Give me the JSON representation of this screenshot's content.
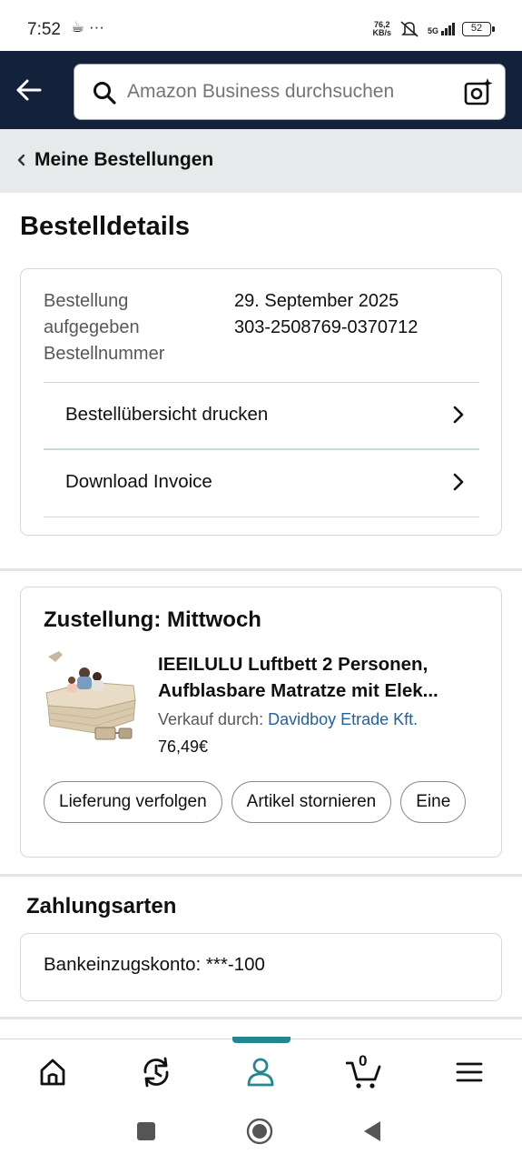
{
  "status_bar": {
    "time": "7:52",
    "notif_icons": "☕ ···",
    "speed_value": "76,2",
    "speed_unit": "KB/s",
    "network": "5G",
    "battery": "52"
  },
  "header": {
    "search_placeholder": "Amazon Business durchsuchen"
  },
  "breadcrumb": {
    "label": "Meine Bestellungen"
  },
  "page_title": "Bestelldetails",
  "order": {
    "label_placed_1": "Bestellung",
    "label_placed_2": "aufgegeben",
    "label_number": "Bestellnummer",
    "date": "29. September 2025",
    "number": "303-2508769-0370712",
    "print_link": "Bestellübersicht drucken",
    "invoice_link": "Download Invoice"
  },
  "delivery": {
    "title": "Zustellung: Mittwoch",
    "product_title_line1": "IEEILULU Luftbett 2 Personen,",
    "product_title_line2": "Aufblasbare Matratze mit Elek...",
    "seller_prefix": "Verkauf durch:",
    "seller_name": "Davidboy Etrade Kft.",
    "price": "76,49€",
    "buttons": [
      "Lieferung verfolgen",
      "Artikel stornieren",
      "Eine"
    ]
  },
  "payment": {
    "title": "Zahlungsarten",
    "method": "Bankeinzugskonto: ***-100"
  },
  "bottom_nav": {
    "cart_count": "0",
    "active": "account",
    "accent_color": "#218891"
  },
  "colors": {
    "header_bg": "#13213a",
    "link": "#2162a1"
  }
}
